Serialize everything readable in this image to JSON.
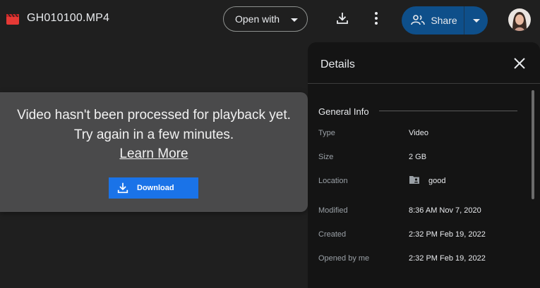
{
  "header": {
    "file_name": "GH010100.MP4",
    "open_with_label": "Open with",
    "share_label": "Share"
  },
  "message": {
    "line1": "Video hasn't been processed for playback yet.",
    "line2": "Try again in a few minutes.",
    "learn_more": "Learn More",
    "download_label": "Download"
  },
  "details": {
    "title": "Details",
    "section": "General Info",
    "rows": [
      {
        "key": "Type",
        "value": "Video"
      },
      {
        "key": "Size",
        "value": "2 GB"
      },
      {
        "key": "Location",
        "value": "good"
      },
      {
        "key": "Modified",
        "value": "8:36 AM Nov 7, 2020"
      },
      {
        "key": "Created",
        "value": "2:32 PM Feb 19, 2022"
      },
      {
        "key": "Opened by me",
        "value": "2:32 PM Feb 19, 2022"
      }
    ]
  },
  "icons": {
    "file": "video-file-icon",
    "download": "download-icon",
    "more": "more-vert-icon",
    "share": "people-icon",
    "close": "close-icon",
    "folder": "shared-folder-icon"
  },
  "colors": {
    "background": "#1f1f1f",
    "panel": "#141414",
    "share_button": "#0e4f8a",
    "download_button": "#1a73e8",
    "file_icon": "#e53935"
  }
}
